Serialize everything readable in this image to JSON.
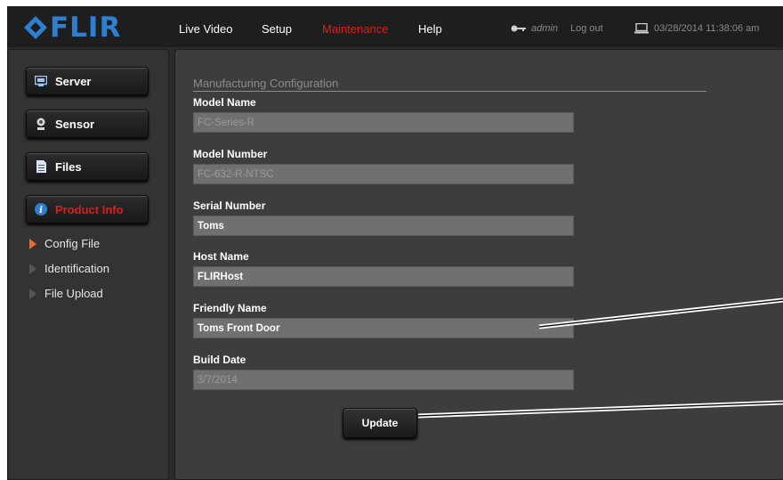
{
  "brand": {
    "logo_text": "FLIR",
    "color": "#2f7fd0"
  },
  "nav": {
    "items": [
      {
        "label": "Live Video"
      },
      {
        "label": "Setup"
      },
      {
        "label": "Maintenance",
        "active": true
      },
      {
        "label": "Help"
      }
    ],
    "active_color": "#e01c1c"
  },
  "user": {
    "name": "admin",
    "logout_label": "Log out"
  },
  "datetime": "03/28/2014 11:38:06 am",
  "sidebar": {
    "buttons": [
      {
        "label": "Server",
        "icon": "server-icon"
      },
      {
        "label": "Sensor",
        "icon": "sensor-icon"
      },
      {
        "label": "Files",
        "icon": "files-icon"
      },
      {
        "label": "Product Info",
        "icon": "info-icon",
        "active": true
      }
    ],
    "sub_items": [
      {
        "label": "Config File",
        "active": true
      },
      {
        "label": "Identification"
      },
      {
        "label": "File Upload"
      }
    ]
  },
  "form": {
    "section_title": "Manufacturing Configuration",
    "fields": [
      {
        "label": "Model Name",
        "value": "FC-Series-R",
        "editable": false
      },
      {
        "label": "Model Number",
        "value": "FC-632-R-NTSC",
        "editable": false
      },
      {
        "label": "Serial Number",
        "value": "Toms",
        "editable": true
      },
      {
        "label": "Host Name",
        "value": "FLIRHost",
        "editable": true
      },
      {
        "label": "Friendly Name",
        "value": "Toms Front Door",
        "editable": true
      },
      {
        "label": "Build Date",
        "value": "3/7/2014",
        "editable": false
      }
    ],
    "update_label": "Update"
  }
}
